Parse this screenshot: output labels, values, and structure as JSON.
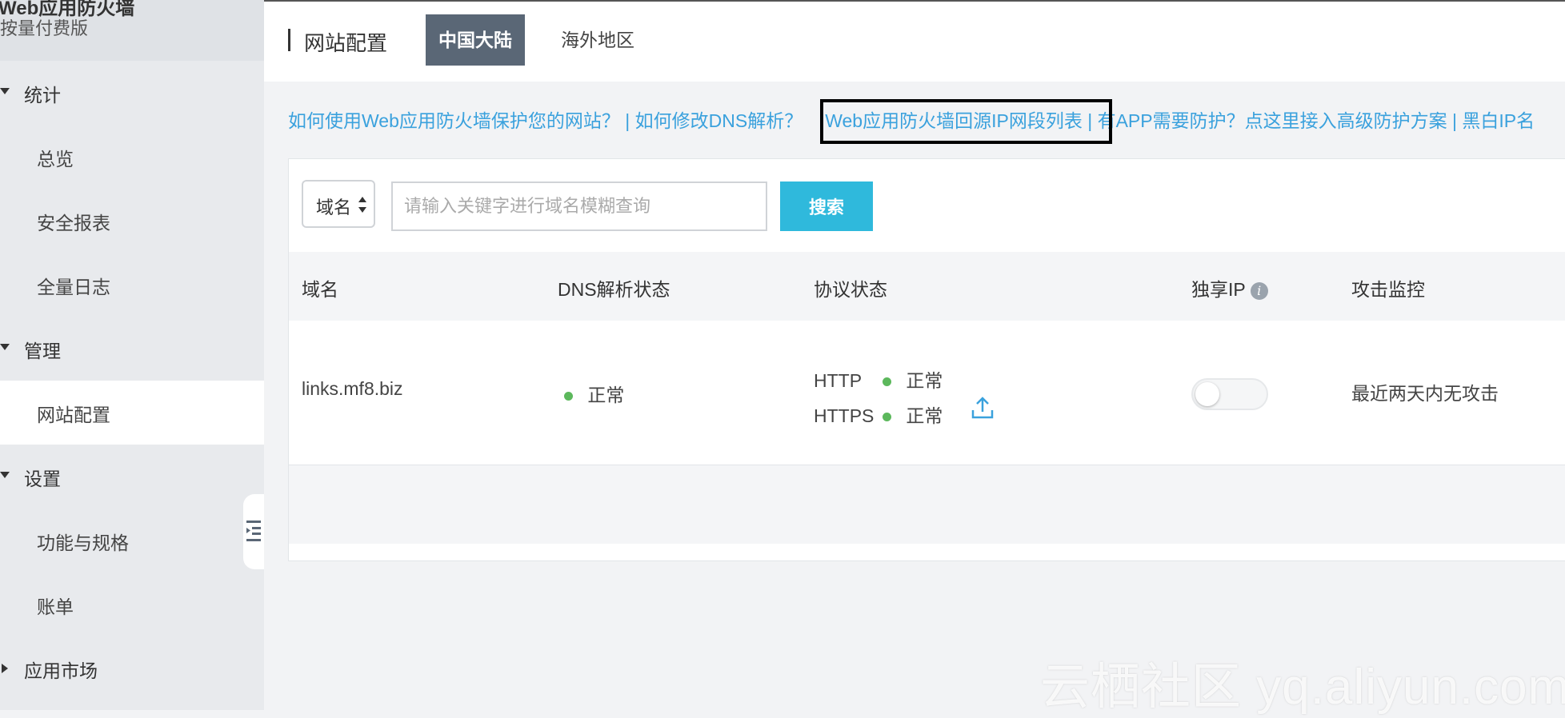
{
  "sidebar": {
    "title": "Web应用防火墙",
    "subtitle": "按量付费版",
    "groups": [
      {
        "label": "统计",
        "items": [
          "总览",
          "安全报表",
          "全量日志"
        ]
      },
      {
        "label": "管理",
        "items": [
          "网站配置"
        ]
      },
      {
        "label": "设置",
        "items": [
          "功能与规格",
          "账单"
        ]
      },
      {
        "label": "应用市场",
        "items": []
      }
    ],
    "active_item": "网站配置"
  },
  "header": {
    "page_title": "网站配置",
    "tabs": [
      "中国大陆",
      "海外地区"
    ],
    "active_tab": "中国大陆"
  },
  "links": {
    "link1": "如何使用Web应用防火墙保护您的网站？",
    "sep1": " | ",
    "link2": "如何修改DNS解析？",
    "link3": "Web应用防火墙回源IP网段列表",
    "sep2": " | ",
    "link4": "有APP需要防护？点这里接入高级防护方案",
    "sep3": " | ",
    "link5": "黑白IP名"
  },
  "filter": {
    "select_value": "域名",
    "search_placeholder": "请输入关键字进行域名模糊查询",
    "search_button": "搜索"
  },
  "table": {
    "columns": [
      "域名",
      "DNS解析状态",
      "协议状态",
      "独享IP",
      "攻击监控"
    ],
    "info_icon_glyph": "i",
    "rows": [
      {
        "domain": "links.mf8.biz",
        "dns_status": "正常",
        "protocols": [
          {
            "name": "HTTP",
            "status": "正常"
          },
          {
            "name": "HTTPS",
            "status": "正常"
          }
        ],
        "exclusive_ip": false,
        "attack_monitor": "最近两天内无攻击"
      }
    ]
  },
  "colors": {
    "link": "#3aa1dd",
    "active_tab_bg": "#5a6776",
    "search_button": "#2fb9dc",
    "status_ok": "#5cb85c"
  },
  "watermark": "云栖社区 yq.aliyun.com"
}
